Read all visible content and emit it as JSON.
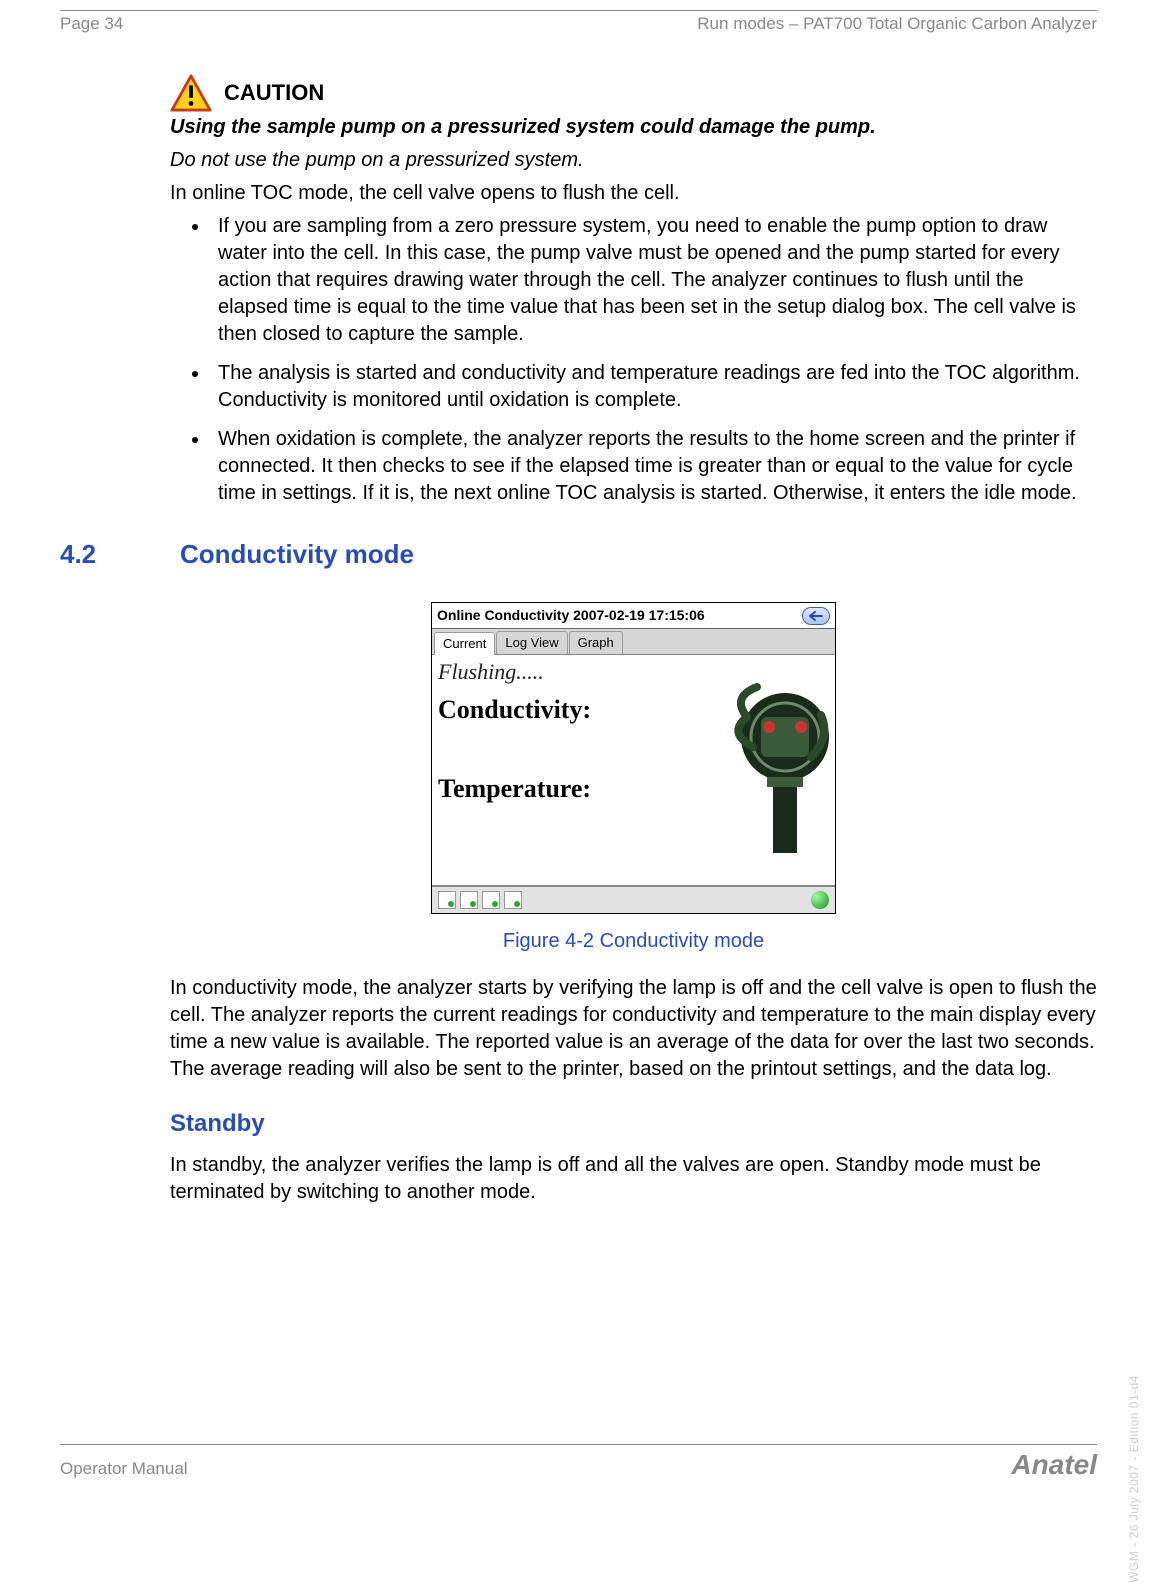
{
  "header": {
    "page_label": "Page 34",
    "doc_title": "Run modes – PAT700 Total Organic Carbon Analyzer"
  },
  "caution": {
    "word": "CAUTION",
    "title": "Using the sample pump on a pressurized system could damage the pump.",
    "sub": "Do not use the pump on a pressurized system.",
    "lead": "In online TOC mode, the cell valve opens to flush the cell.",
    "bullets": [
      "If you are sampling from a zero pressure system, you need to enable the pump option to draw water into the cell. In this case, the pump valve must be opened and the pump started for every action that requires drawing water through the cell. The analyzer continues to flush until the elapsed time is equal to the time value that has been set in the setup dialog box. The cell valve is then closed to capture the sample.",
      "The analysis is started and conductivity and temperature readings are fed into the TOC algorithm. Conductivity is monitored until oxidation is complete.",
      "When oxidation is complete, the analyzer reports the results to the home screen and the printer if connected. It then checks to see if the elapsed time is greater than or equal to the value for cycle time in settings. If it is, the next online TOC analysis is started. Otherwise, it enters the idle mode."
    ]
  },
  "section": {
    "num": "4.2",
    "title": "Conductivity mode"
  },
  "screenshot": {
    "header_text": "Online Conductivity   2007-02-19 17:15:06",
    "tabs": {
      "current": "Current",
      "log": "Log View",
      "graph": "Graph"
    },
    "flushing": "Flushing.....",
    "conductivity_label": "Conductivity:",
    "temperature_label": "Temperature:"
  },
  "figure_caption": "Figure 4-2 Conductivity mode",
  "conductivity_para": "In conductivity mode, the analyzer starts by verifying the lamp is off and the cell valve is open to flush the cell. The analyzer reports the current readings for conductivity and temperature to the main display every time a new value is available. The reported value is an average of the data for over the last two seconds. The average reading will also be sent to the printer, based on the printout settings, and the data log.",
  "standby": {
    "title": "Standby",
    "para": "In standby, the analyzer verifies the lamp is off and all the valves are open. Standby mode must be terminated by switching to another mode."
  },
  "footer": {
    "left": "Operator Manual",
    "brand": "Anatel"
  },
  "side_text": "WGM - 26 July 2007 - Edition 01-d4"
}
